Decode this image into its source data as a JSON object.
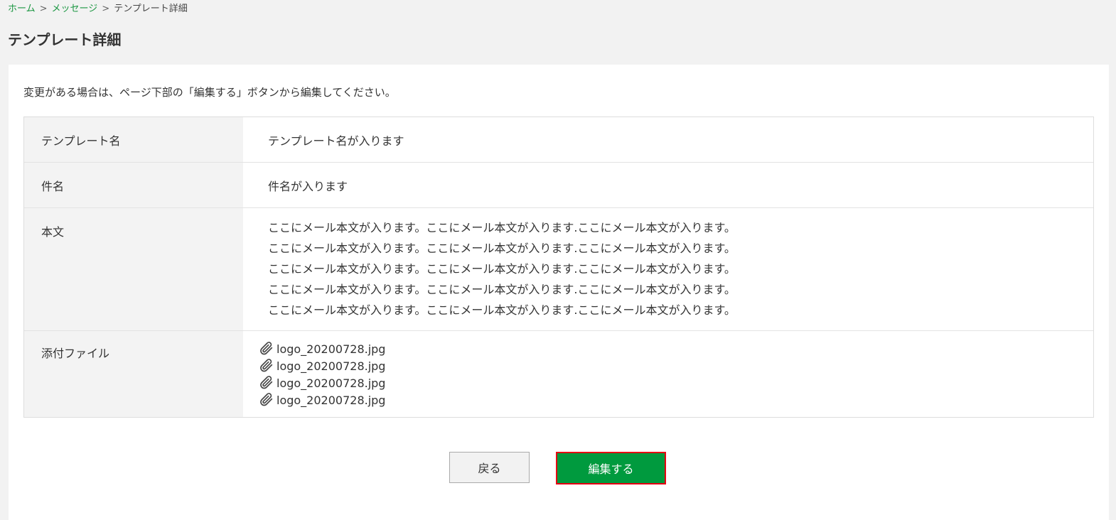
{
  "breadcrumb": {
    "home": "ホーム",
    "separator": ">",
    "messages": "メッセージ",
    "current": "テンプレート詳細"
  },
  "page_title": "テンプレート詳細",
  "notice": "変更がある場合は、ページ下部の「編集する」ボタンから編集してください。",
  "table": {
    "name_label": "テンプレート名",
    "name_value": "テンプレート名が入ります",
    "subject_label": "件名",
    "subject_value": "件名が入ります",
    "body_label": "本文",
    "body_lines": [
      "ここにメール本文が入ります。ここにメール本文が入ります.ここにメール本文が入ります。",
      "ここにメール本文が入ります。ここにメール本文が入ります.ここにメール本文が入ります。",
      "ここにメール本文が入ります。ここにメール本文が入ります.ここにメール本文が入ります。",
      "ここにメール本文が入ります。ここにメール本文が入ります.ここにメール本文が入ります。",
      "ここにメール本文が入ります。ここにメール本文が入ります.ここにメール本文が入ります。"
    ],
    "attach_label": "添付ファイル",
    "attachments": [
      "logo_20200728.jpg",
      "logo_20200728.jpg",
      "logo_20200728.jpg",
      "logo_20200728.jpg"
    ],
    "attachment_icon": "paperclip-icon"
  },
  "buttons": {
    "back": "戻る",
    "edit": "編集する"
  },
  "colors": {
    "link": "#1a9641",
    "primary_button": "#009a3e",
    "primary_button_border": "#e60012",
    "header_cell_bg": "#f3f3f3",
    "page_bg": "#f2f2f2"
  }
}
